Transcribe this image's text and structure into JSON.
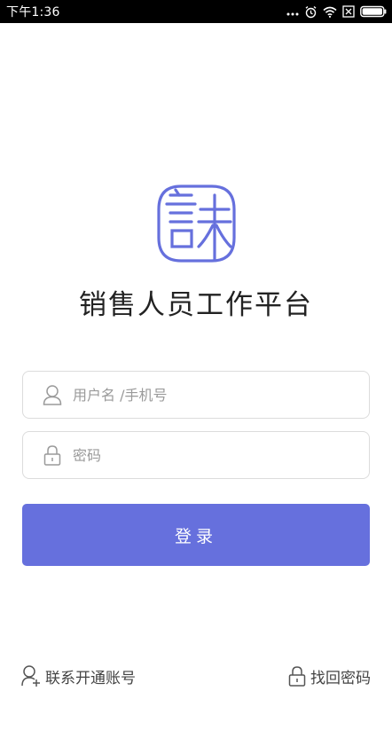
{
  "status_bar": {
    "time": "下午1:36",
    "icons": [
      "more-dots-icon",
      "alarm-icon",
      "wifi-icon",
      "sim-off-icon",
      "battery-icon"
    ]
  },
  "app": {
    "logo": "logo-seal-icon",
    "title": "销售人员工作平台"
  },
  "login_form": {
    "username_placeholder": "用户名 /手机号",
    "username_value": "",
    "password_placeholder": "密码",
    "password_value": "",
    "login_label": "登录"
  },
  "footer_links": {
    "contact_label": "联系开通账号",
    "recover_label": "找回密码"
  },
  "colors": {
    "accent": "#6670dd",
    "border": "#dcdcdc",
    "placeholder": "#9a9a9a",
    "title_text": "#222222"
  }
}
